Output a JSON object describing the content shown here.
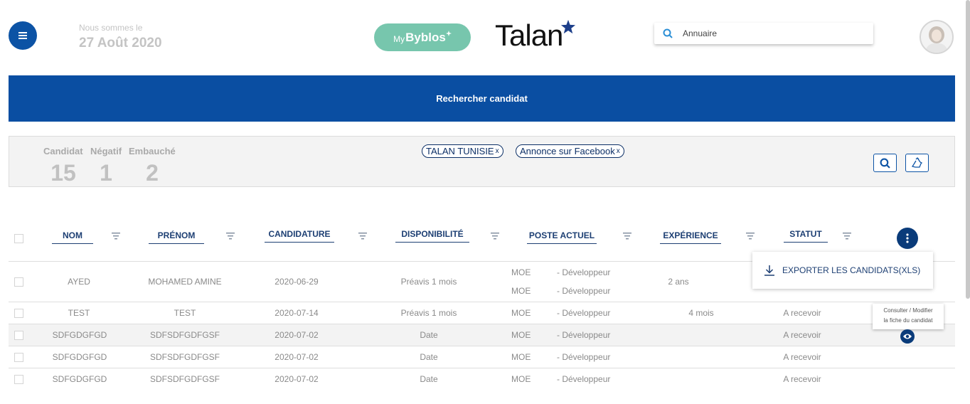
{
  "header": {
    "date_prefix": "Nous sommes le",
    "date": "27 Août 2020",
    "mybyblos_prefix": "My",
    "mybyblos_name": "Byblos",
    "logo": "Talan",
    "search_placeholder": "Annuaire"
  },
  "banner": {
    "label": "Rechercher candidat"
  },
  "stats": [
    {
      "label": "Candidat",
      "value": "15"
    },
    {
      "label": "Négatif",
      "value": "1"
    },
    {
      "label": "Embauché",
      "value": "2"
    }
  ],
  "filters": [
    {
      "label": "TALAN TUNISIE",
      "remove": "x"
    },
    {
      "label": "Annonce sur Facebook",
      "remove": "x"
    }
  ],
  "columns": [
    "NOM",
    "PRÉNOM",
    "CANDIDATURE",
    "DISPONIBILITÉ",
    "POSTE ACTUEL",
    "EXPÉRIENCE",
    "STATUT"
  ],
  "rows": [
    {
      "nom": "AYED",
      "prenom": "MOHAMED AMINE",
      "candidature": "2020-06-29",
      "disponibilite": "Préavis 1 mois",
      "postes": [
        {
          "code": "MOE",
          "role": "- Développeur"
        },
        {
          "code": "MOE",
          "role": "- Développeur"
        }
      ],
      "experience": "2 ans",
      "statut": ""
    },
    {
      "nom": "TEST",
      "prenom": "TEST",
      "candidature": "2020-07-14",
      "disponibilite": "Préavis 1 mois",
      "postes": [
        {
          "code": "MOE",
          "role": "- Développeur"
        }
      ],
      "experience": "4 mois",
      "statut": "A recevoir"
    },
    {
      "nom": "SDFGDGFGD",
      "prenom": "SDFSDFGDFGSF",
      "candidature": "2020-07-02",
      "disponibilite": "Date",
      "postes": [
        {
          "code": "MOE",
          "role": "- Développeur"
        }
      ],
      "experience": "",
      "statut": "A recevoir"
    },
    {
      "nom": "SDFGDGFGD",
      "prenom": "SDFSDFGDFGSF",
      "candidature": "2020-07-02",
      "disponibilite": "Date",
      "postes": [
        {
          "code": "MOE",
          "role": "- Développeur"
        }
      ],
      "experience": "",
      "statut": "A recevoir"
    },
    {
      "nom": "SDFGDGFGD",
      "prenom": "SDFSDFGDFGSF",
      "candidature": "2020-07-02",
      "disponibilite": "Date",
      "postes": [
        {
          "code": "MOE",
          "role": "- Développeur"
        }
      ],
      "experience": "",
      "statut": "A recevoir"
    }
  ],
  "menu": {
    "export_label": "EXPORTER LES CANDIDATS(XLS)"
  },
  "tooltip": {
    "line1": "Consulter / Modifier",
    "line2": "la fiche du candidat"
  },
  "colors": {
    "primary": "#0a4ea2",
    "dark": "#0a3b7a",
    "mint": "#77c6ad",
    "star": "#1d3f8a"
  }
}
